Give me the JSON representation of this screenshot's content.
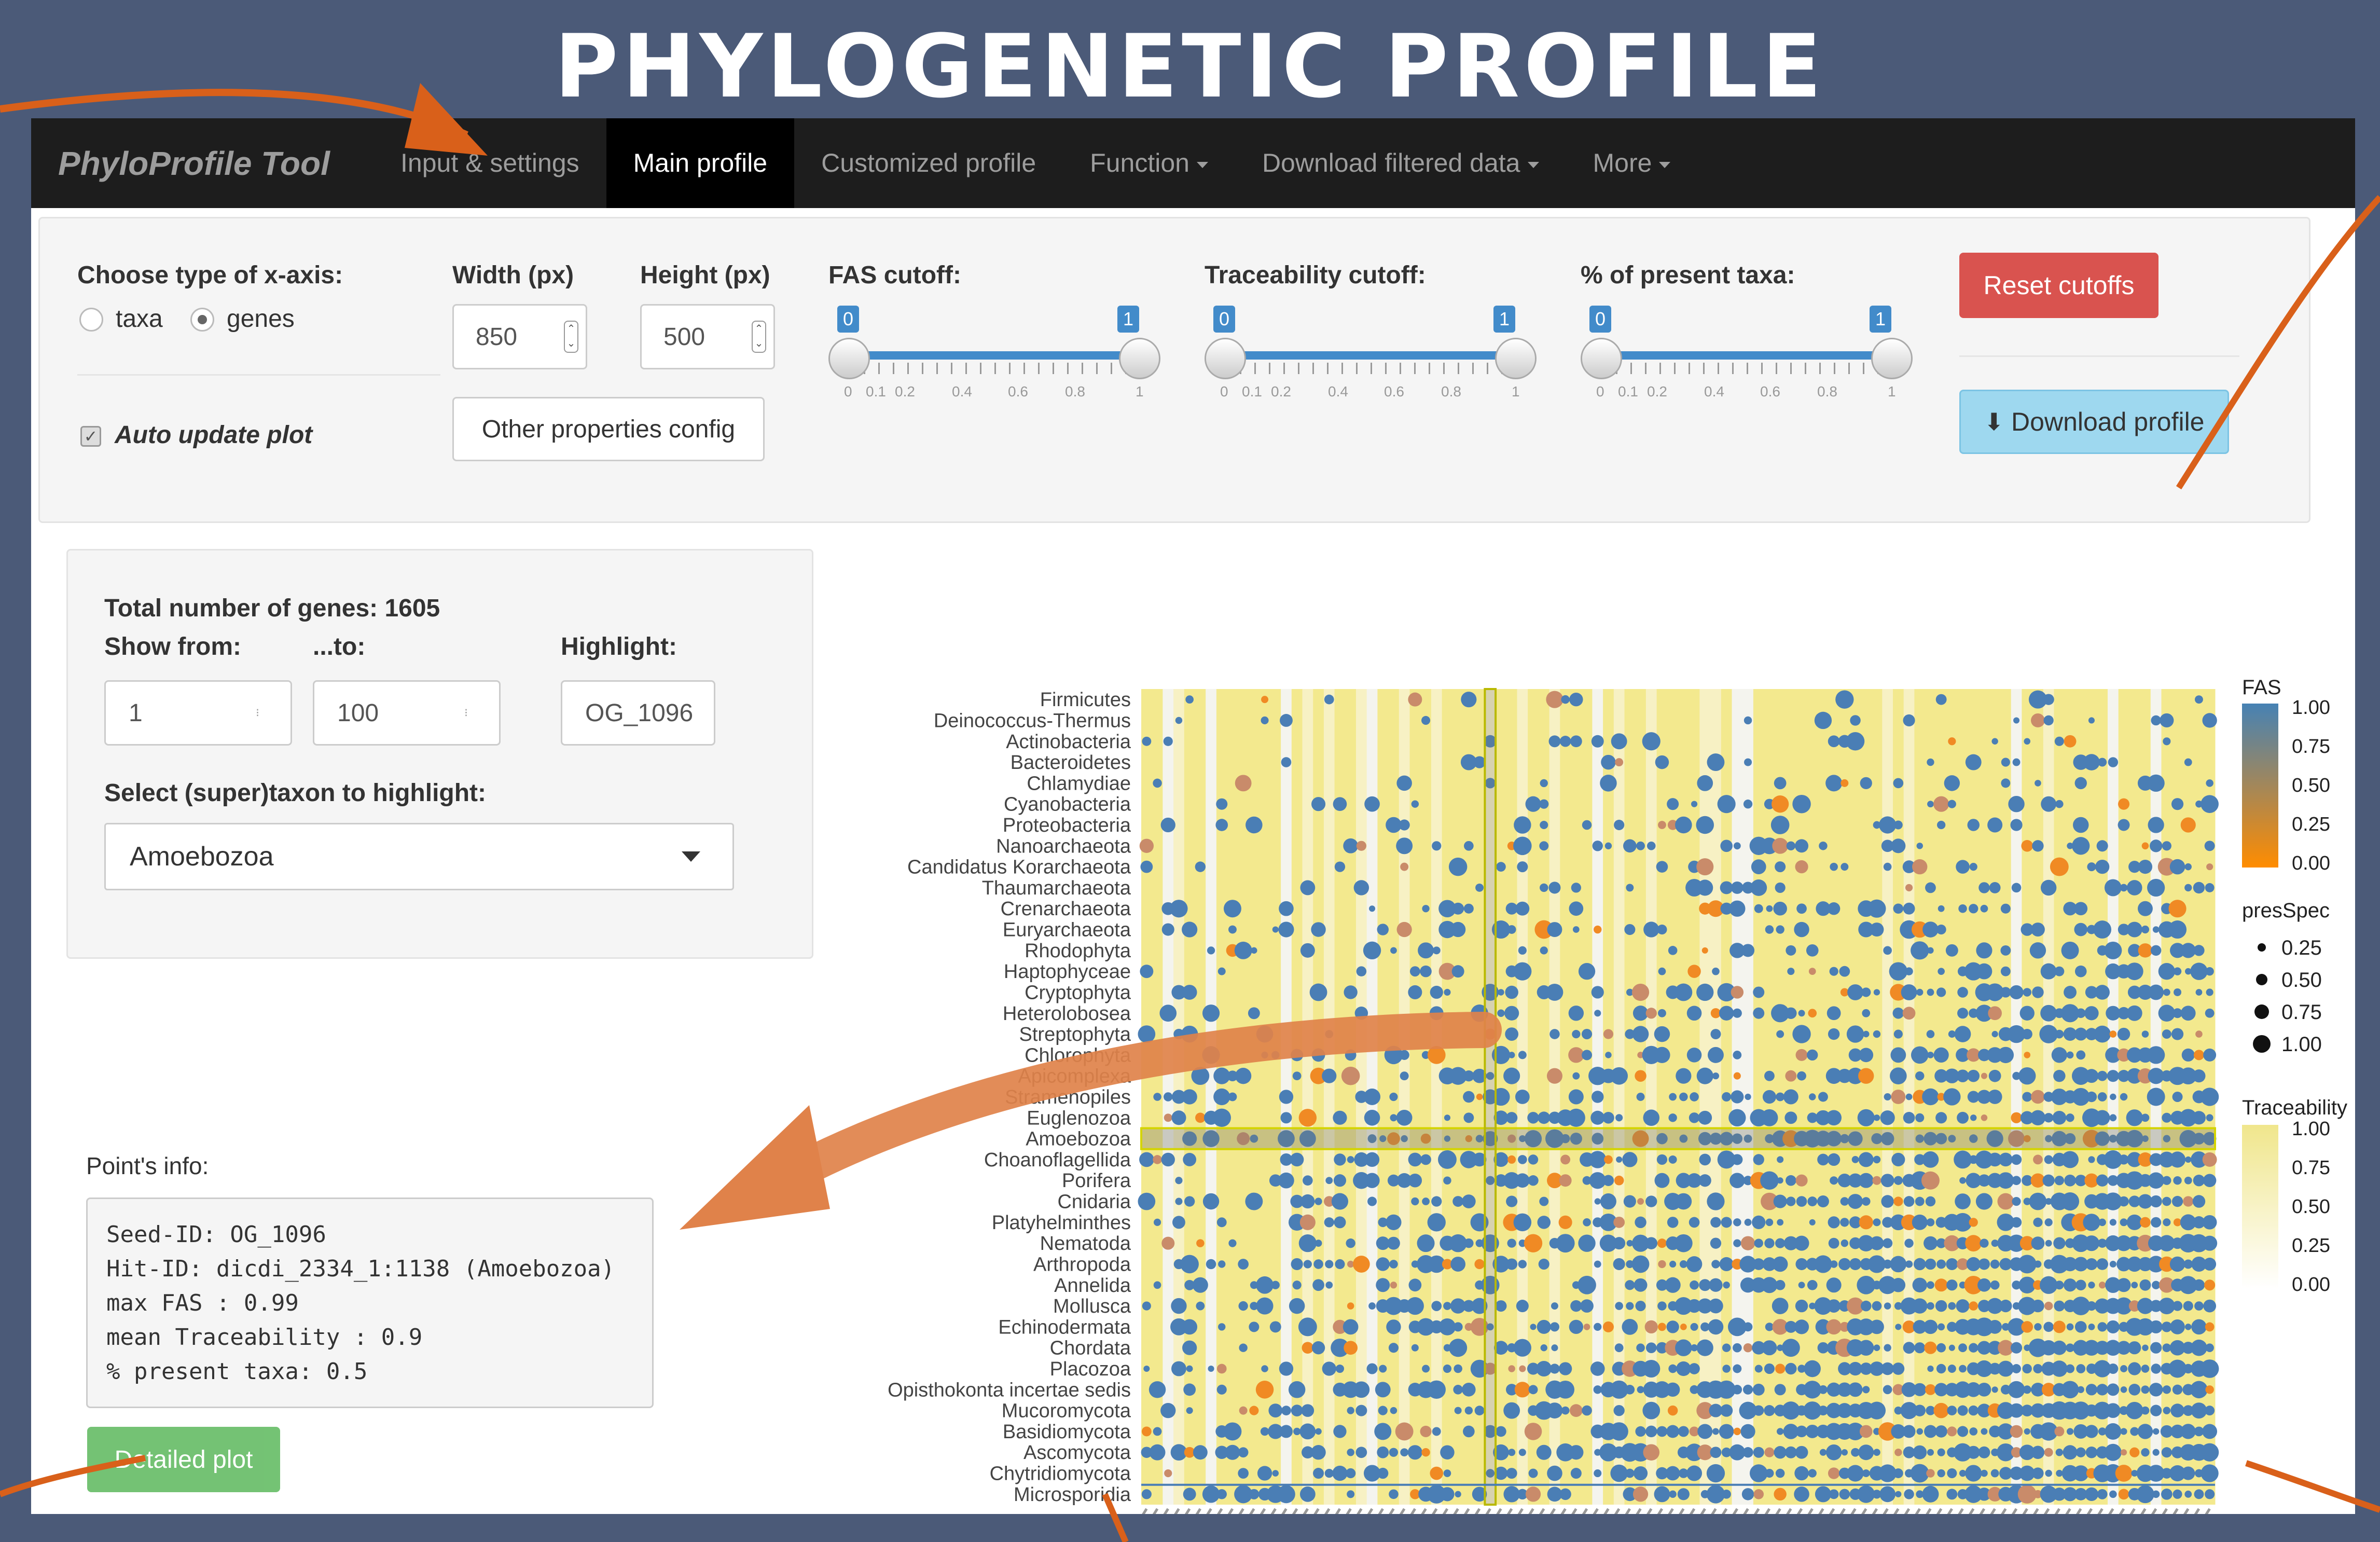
{
  "title": "PHYLOGENETIC PROFILE",
  "navbar": {
    "brand": "PhyloProfile Tool",
    "items": [
      {
        "label": "Input & settings",
        "active": false,
        "dropdown": false
      },
      {
        "label": "Main profile",
        "active": true,
        "dropdown": false
      },
      {
        "label": "Customized profile",
        "active": false,
        "dropdown": false
      },
      {
        "label": "Function",
        "active": false,
        "dropdown": true
      },
      {
        "label": "Download filtered data",
        "active": false,
        "dropdown": true
      },
      {
        "label": "More",
        "active": false,
        "dropdown": true
      }
    ]
  },
  "settings": {
    "xaxis_label": "Choose type of x-axis:",
    "option_taxa": "taxa",
    "option_genes": "genes",
    "selected": "genes",
    "auto_update": "Auto update plot",
    "width_label": "Width (px)",
    "width_value": "850",
    "height_label": "Height (px)",
    "height_value": "500",
    "other_props": "Other properties config",
    "fas_label": "FAS cutoff:",
    "trace_label": "Traceability cutoff:",
    "present_label": "% of present taxa:",
    "slider_min": "0",
    "slider_max": "1",
    "tick_labels": [
      "0",
      "0.1",
      "0.2",
      "0.4",
      "0.6",
      "0.8",
      "1"
    ],
    "reset": "Reset cutoffs",
    "download": "Download profile"
  },
  "genes": {
    "total": "Total number of genes: 1605",
    "show_from": "Show from:",
    "to": "...to:",
    "highlight": "Highlight:",
    "from_value": "1",
    "to_value": "100",
    "highlight_value": "OG_1096",
    "select_label": "Select (super)taxon to highlight:",
    "select_value": "Amoebozoa"
  },
  "point": {
    "label": "Point's info:",
    "lines": [
      "Seed-ID: OG_1096",
      "Hit-ID: dicdi_2334_1:1138 (Amoebozoa)",
      "max FAS : 0.99",
      "mean Traceability : 0.9",
      "% present taxa: 0.5"
    ]
  },
  "detail_btn": "Detailed plot",
  "colors": {
    "fas_high": "#4682b4",
    "fas_low": "#ff8c00",
    "trace_high": "#f0e68c",
    "trace_low": "#ffffff",
    "highlight": "#d4d400",
    "danger": "#d9534f",
    "info": "#9ed8ef",
    "success": "#5cb85c"
  },
  "chart_data": {
    "type": "scatter",
    "taxa": [
      "Firmicutes",
      "Deinococcus-Thermus",
      "Actinobacteria",
      "Bacteroidetes",
      "Chlamydiae",
      "Cyanobacteria",
      "Proteobacteria",
      "Nanoarchaeota",
      "Candidatus Korarchaeota",
      "Thaumarchaeota",
      "Crenarchaeota",
      "Euryarchaeota",
      "Rhodophyta",
      "Haptophyceae",
      "Cryptophyta",
      "Heterolobosea",
      "Streptophyta",
      "Chlorophyta",
      "Apicomplexa",
      "Stramenopiles",
      "Euglenozoa",
      "Amoebozoa",
      "Choanoflagellida",
      "Porifera",
      "Cnidaria",
      "Platyhelminthes",
      "Nematoda",
      "Arthropoda",
      "Annelida",
      "Mollusca",
      "Echinodermata",
      "Chordata",
      "Placozoa",
      "Opisthokonta incertae sedis",
      "Mucoromycota",
      "Basidiomycota",
      "Ascomycota",
      "Chytridiomycota",
      "Microsporidia"
    ],
    "gene_count": 100,
    "highlight_taxon": "Amoebozoa",
    "highlight_gene": "OG_1096",
    "legend": {
      "fas": {
        "title": "FAS",
        "labels": [
          "1.00",
          "0.75",
          "0.50",
          "0.25",
          "0.00"
        ]
      },
      "presSpec": {
        "title": "presSpec",
        "labels": [
          "0.25",
          "0.50",
          "0.75",
          "1.00"
        ]
      },
      "traceability": {
        "title": "Traceability",
        "labels": [
          "1.00",
          "0.75",
          "0.50",
          "0.25",
          "0.00"
        ]
      }
    }
  }
}
